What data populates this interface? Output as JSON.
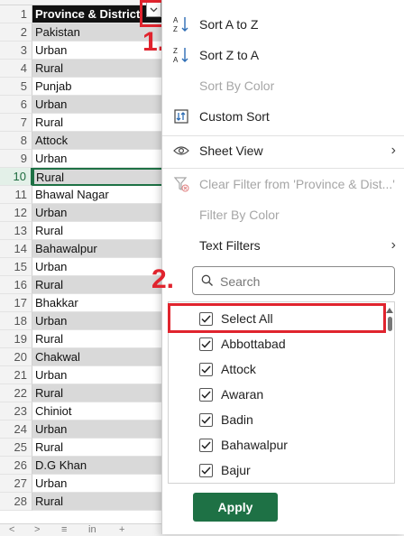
{
  "sheet": {
    "rows": [
      {
        "num": "1",
        "value": "Province & District",
        "style": "header"
      },
      {
        "num": "2",
        "value": "Pakistan",
        "style": "gray"
      },
      {
        "num": "3",
        "value": "Urban",
        "style": "plain"
      },
      {
        "num": "4",
        "value": "Rural",
        "style": "gray"
      },
      {
        "num": "5",
        "value": "Punjab",
        "style": "plain"
      },
      {
        "num": "6",
        "value": "Urban",
        "style": "gray"
      },
      {
        "num": "7",
        "value": "Rural",
        "style": "plain"
      },
      {
        "num": "8",
        "value": "Attock",
        "style": "gray"
      },
      {
        "num": "9",
        "value": "Urban",
        "style": "plain"
      },
      {
        "num": "10",
        "value": "Rural",
        "style": "gray"
      },
      {
        "num": "11",
        "value": "Bhawal Nagar",
        "style": "plain"
      },
      {
        "num": "12",
        "value": "Urban",
        "style": "gray"
      },
      {
        "num": "13",
        "value": "Rural",
        "style": "plain"
      },
      {
        "num": "14",
        "value": "Bahawalpur",
        "style": "gray"
      },
      {
        "num": "15",
        "value": "Urban",
        "style": "plain"
      },
      {
        "num": "16",
        "value": "Rural",
        "style": "gray"
      },
      {
        "num": "17",
        "value": "Bhakkar",
        "style": "plain"
      },
      {
        "num": "18",
        "value": "Urban",
        "style": "gray"
      },
      {
        "num": "19",
        "value": "Rural",
        "style": "plain"
      },
      {
        "num": "20",
        "value": "Chakwal",
        "style": "gray"
      },
      {
        "num": "21",
        "value": "Urban",
        "style": "plain"
      },
      {
        "num": "22",
        "value": "Rural",
        "style": "gray"
      },
      {
        "num": "23",
        "value": "Chiniot",
        "style": "plain"
      },
      {
        "num": "24",
        "value": "Urban",
        "style": "gray"
      },
      {
        "num": "25",
        "value": "Rural",
        "style": "plain"
      },
      {
        "num": "26",
        "value": "D.G Khan",
        "style": "gray"
      },
      {
        "num": "27",
        "value": "Urban",
        "style": "plain"
      },
      {
        "num": "28",
        "value": "Rural",
        "style": "gray"
      }
    ],
    "active_row": "10"
  },
  "annotations": {
    "step1": "1.",
    "step2": "2."
  },
  "tabbar": {
    "items": [
      "<",
      ">",
      "≡",
      "in",
      "+"
    ]
  },
  "filter_menu": {
    "sort_az": "Sort A to Z",
    "sort_za": "Sort Z to A",
    "sort_by_color": "Sort By Color",
    "custom_sort": "Custom Sort",
    "sheet_view": "Sheet View",
    "clear_filter": "Clear Filter from 'Province & Dist...'",
    "filter_by_color": "Filter By Color",
    "text_filters": "Text Filters",
    "search_placeholder": "Search",
    "apply_label": "Apply",
    "list": [
      {
        "label": "Select All",
        "checked": true
      },
      {
        "label": "Abbottabad",
        "checked": true
      },
      {
        "label": "Attock",
        "checked": true
      },
      {
        "label": "Awaran",
        "checked": true
      },
      {
        "label": "Badin",
        "checked": true
      },
      {
        "label": "Bahawalpur",
        "checked": true
      },
      {
        "label": "Bajur",
        "checked": true
      }
    ]
  },
  "colors": {
    "accent": "#1e7145",
    "annotation": "#e0242e",
    "header_fill": "#111111",
    "band_fill": "#d9d9d9"
  }
}
